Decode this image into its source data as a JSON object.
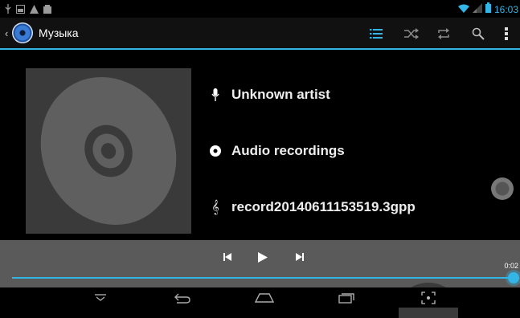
{
  "status_bar": {
    "left_icons": [
      "usb-icon",
      "image-icon",
      "warning-icon",
      "storage-icon"
    ],
    "right_icons": [
      "wifi-icon",
      "signal-icon",
      "battery-icon"
    ],
    "time": "16:03"
  },
  "action_bar": {
    "title": "Музыка",
    "actions": [
      "playlist-icon",
      "shuffle-icon",
      "repeat-icon",
      "search-icon",
      "overflow-menu-icon"
    ]
  },
  "track": {
    "artist": "Unknown artist",
    "album": "Audio recordings",
    "title": "record20140611153519.3gpp"
  },
  "player": {
    "elapsed": "0:02",
    "progress": 1.0
  },
  "colors": {
    "accent": "#33b5e5",
    "control_panel": "#5a5a5a",
    "art_bg": "#3a3a3a",
    "disc": "#5f5f5f"
  }
}
